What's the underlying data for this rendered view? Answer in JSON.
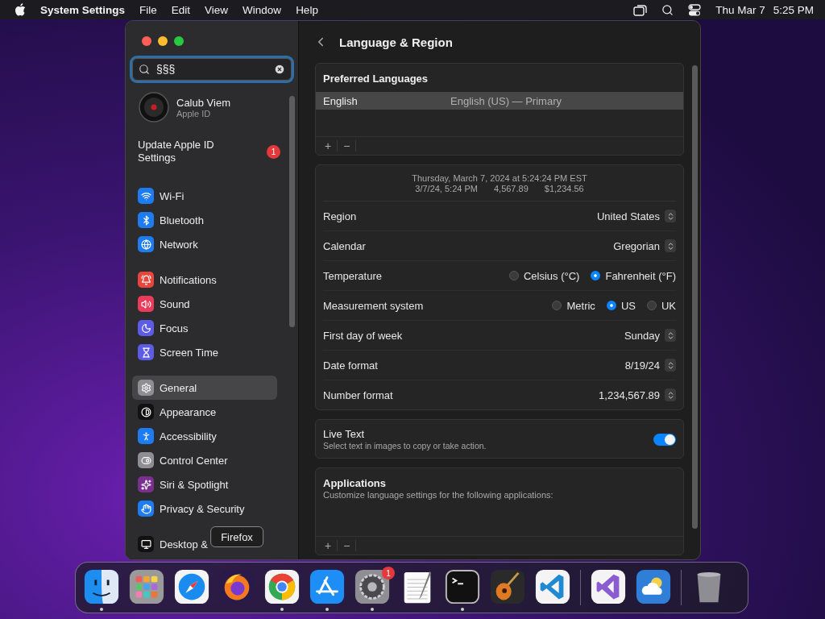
{
  "menu_bar": {
    "app": "System Settings",
    "menus": [
      "File",
      "Edit",
      "View",
      "Window",
      "Help"
    ],
    "date": "Thu Mar 7",
    "time": "5:25 PM"
  },
  "sidebar": {
    "search": {
      "value": "§§§",
      "focused": true
    },
    "account": {
      "name": "Calub Viem",
      "subtitle": "Apple ID"
    },
    "notice": {
      "text": "Update Apple ID Settings",
      "badge": "1"
    },
    "groups": [
      {
        "items": [
          {
            "label": "Wi-Fi",
            "kind": "wifi",
            "selected": false
          },
          {
            "label": "Bluetooth",
            "kind": "bluetooth",
            "selected": false
          },
          {
            "label": "Network",
            "kind": "network",
            "selected": false
          }
        ]
      },
      {
        "items": [
          {
            "label": "Notifications",
            "kind": "notifications",
            "selected": false
          },
          {
            "label": "Sound",
            "kind": "sound",
            "selected": false
          },
          {
            "label": "Focus",
            "kind": "focus",
            "selected": false
          },
          {
            "label": "Screen Time",
            "kind": "screentime",
            "selected": false
          }
        ]
      },
      {
        "items": [
          {
            "label": "General",
            "kind": "general",
            "selected": true
          },
          {
            "label": "Appearance",
            "kind": "appearance",
            "selected": false
          },
          {
            "label": "Accessibility",
            "kind": "accessibility",
            "selected": false
          },
          {
            "label": "Control Center",
            "kind": "controlcenter",
            "selected": false
          },
          {
            "label": "Siri & Spotlight",
            "kind": "siri",
            "selected": false
          },
          {
            "label": "Privacy & Security",
            "kind": "privacy",
            "selected": false
          }
        ]
      },
      {
        "items": [
          {
            "label": "Desktop &",
            "kind": "desktop",
            "selected": false
          }
        ]
      }
    ]
  },
  "content": {
    "title": "Language & Region",
    "preferred_languages": {
      "title": "Preferred Languages",
      "rows": [
        {
          "language": "English",
          "detail": "English (US) — Primary",
          "selected": true
        }
      ],
      "buttons": [
        "+",
        "−"
      ]
    },
    "format": {
      "preview_line_1": "Thursday, March 7, 2024 at 5:24:24 PM EST",
      "preview_line_2": [
        "3/7/24, 5:24 PM",
        "4,567.89",
        "$1,234.56"
      ],
      "rows": [
        {
          "kind": "popup",
          "label": "Region",
          "value": "United States"
        },
        {
          "kind": "popup",
          "label": "Calendar",
          "value": "Gregorian"
        },
        {
          "kind": "radio",
          "label": "Temperature",
          "options": [
            {
              "label": "Celsius (°C)",
              "selected": false
            },
            {
              "label": "Fahrenheit (°F)",
              "selected": true
            }
          ]
        },
        {
          "kind": "radio",
          "label": "Measurement system",
          "options": [
            {
              "label": "Metric",
              "selected": false
            },
            {
              "label": "US",
              "selected": true
            },
            {
              "label": "UK",
              "selected": false
            }
          ]
        },
        {
          "kind": "popup",
          "label": "First day of week",
          "value": "Sunday"
        },
        {
          "kind": "popup",
          "label": "Date format",
          "value": "8/19/24"
        },
        {
          "kind": "popup",
          "label": "Number format",
          "value": "1,234,567.89"
        }
      ]
    },
    "live_text": {
      "title": "Live Text",
      "subtitle": "Select text in images to copy or take action.",
      "on": true
    },
    "applications": {
      "title": "Applications",
      "subtitle": "Customize language settings for the following applications:",
      "buttons": [
        "+",
        "−"
      ]
    }
  },
  "dock": {
    "sections": [
      [
        {
          "kind": "finder",
          "running": true
        },
        {
          "kind": "launchpad",
          "running": false
        },
        {
          "kind": "safari",
          "running": false
        },
        {
          "kind": "firefox",
          "running": false,
          "tooltip": "Firefox"
        },
        {
          "kind": "chrome",
          "running": true
        },
        {
          "kind": "appstore",
          "running": true
        },
        {
          "kind": "settings",
          "running": true,
          "badge": "1"
        },
        {
          "kind": "textedit",
          "running": false
        },
        {
          "kind": "terminal",
          "running": true
        },
        {
          "kind": "garageband",
          "running": false
        },
        {
          "kind": "vscode",
          "running": false
        }
      ],
      [
        {
          "kind": "visualstudio",
          "running": false
        },
        {
          "kind": "weather",
          "running": false
        }
      ],
      [
        {
          "kind": "trash",
          "running": false
        }
      ]
    ]
  }
}
